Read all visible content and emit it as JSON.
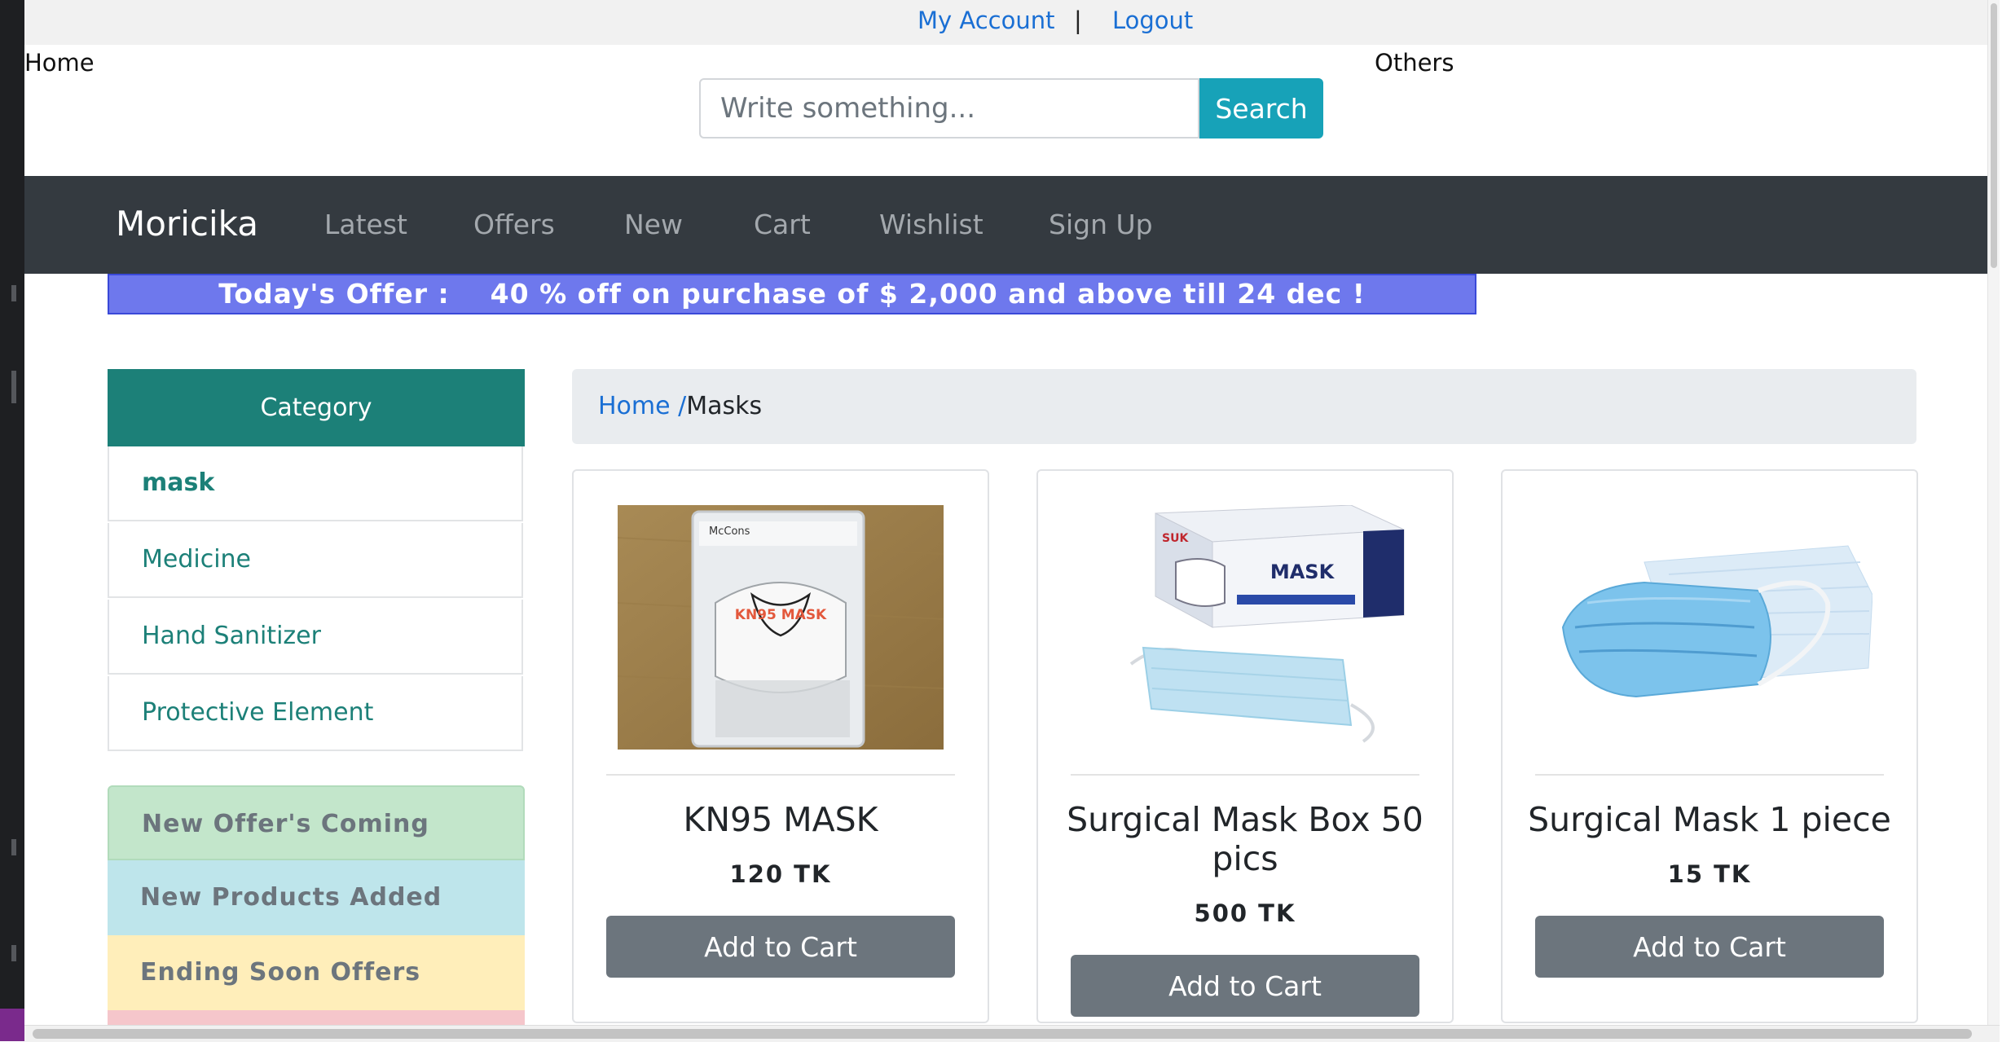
{
  "topbar": {
    "my_account": "My Account",
    "separator": "|",
    "logout": "Logout"
  },
  "top_links": {
    "home": "Home",
    "others": "Others"
  },
  "search": {
    "placeholder": "Write something...",
    "button": "Search"
  },
  "navbar": {
    "brand": "Moricika",
    "items": [
      "Latest",
      "Offers",
      "New",
      "Cart",
      "Wishlist",
      "Sign Up"
    ]
  },
  "offer": {
    "text": "Today's Offer :    40 % off on purchase of $ 2,000 and above till 24 dec !"
  },
  "sidebar": {
    "heading": "Category",
    "categories": [
      "mask",
      "Medicine",
      "Hand Sanitizer",
      "Protective Element"
    ],
    "status_boxes": [
      "New Offer's Coming",
      "New Products Added",
      "Ending Soon Offers"
    ]
  },
  "breadcrumb": {
    "home": "Home /",
    "current": "Masks"
  },
  "products": [
    {
      "title": "KN95 MASK",
      "price": "120 TK",
      "button": "Add to Cart",
      "image_label": "KN95 MASK",
      "brand_label": "McCons"
    },
    {
      "title": "Surgical Mask Box 50 pics",
      "price": "500 TK",
      "button": "Add to Cart",
      "image_label": "MASK",
      "brand_label": "SUK"
    },
    {
      "title": "Surgical Mask 1 piece",
      "price": "15 TK",
      "button": "Add to Cart"
    }
  ],
  "colors": {
    "navbar": "#343a40",
    "category_header": "#1c8078",
    "offer_banner": "#6e78ed",
    "search_button": "#17a2b8",
    "cart_button": "#6c757d",
    "status_green": "#c3e6cb",
    "status_blue": "#bee5eb",
    "status_yellow": "#ffeeba"
  }
}
